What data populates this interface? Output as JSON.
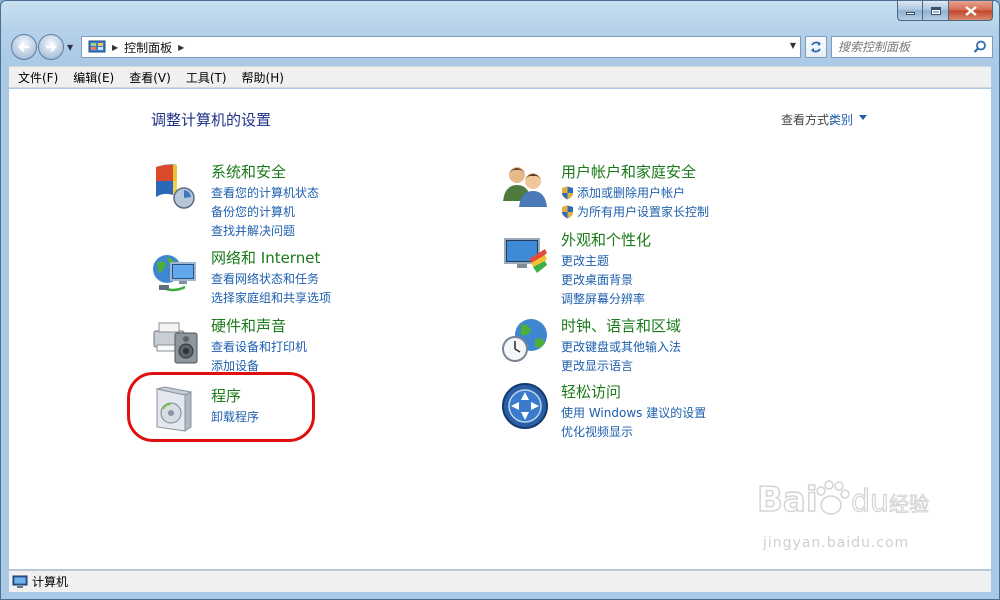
{
  "window": {
    "address_path": "控制面板",
    "search_placeholder": "搜索控制面板"
  },
  "menu": [
    "文件(F)",
    "编辑(E)",
    "查看(V)",
    "工具(T)",
    "帮助(H)"
  ],
  "main": {
    "title": "调整计算机的设置",
    "view_by_label": "查看方式:",
    "view_by_value": "类别"
  },
  "categories": [
    {
      "title": "系统和安全",
      "icon": "system-security-icon",
      "links": [
        "查看您的计算机状态",
        "备份您的计算机",
        "查找并解决问题"
      ]
    },
    {
      "title": "网络和 Internet",
      "icon": "network-internet-icon",
      "links": [
        "查看网络状态和任务",
        "选择家庭组和共享选项"
      ]
    },
    {
      "title": "硬件和声音",
      "icon": "hardware-sound-icon",
      "links": [
        "查看设备和打印机",
        "添加设备"
      ]
    },
    {
      "title": "程序",
      "icon": "programs-icon",
      "links": [
        "卸载程序"
      ]
    },
    {
      "title": "用户帐户和家庭安全",
      "icon": "user-accounts-icon",
      "links": [
        "添加或删除用户帐户",
        "为所有用户设置家长控制"
      ]
    },
    {
      "title": "外观和个性化",
      "icon": "appearance-icon",
      "links": [
        "更改主题",
        "更改桌面背景",
        "调整屏幕分辨率"
      ]
    },
    {
      "title": "时钟、语言和区域",
      "icon": "clock-region-icon",
      "links": [
        "更改键盘或其他输入法",
        "更改显示语言"
      ]
    },
    {
      "title": "轻松访问",
      "icon": "ease-of-access-icon",
      "links": [
        "使用 Windows 建议的设置",
        "优化视频显示"
      ]
    }
  ],
  "status": {
    "text": "计算机"
  },
  "watermark": {
    "text": "jingyan.baidu.com",
    "logo": "Bai du 经验"
  },
  "colors": {
    "link": "#1e5fae",
    "category_title": "#1a7a1a",
    "highlight": "#e01010"
  }
}
